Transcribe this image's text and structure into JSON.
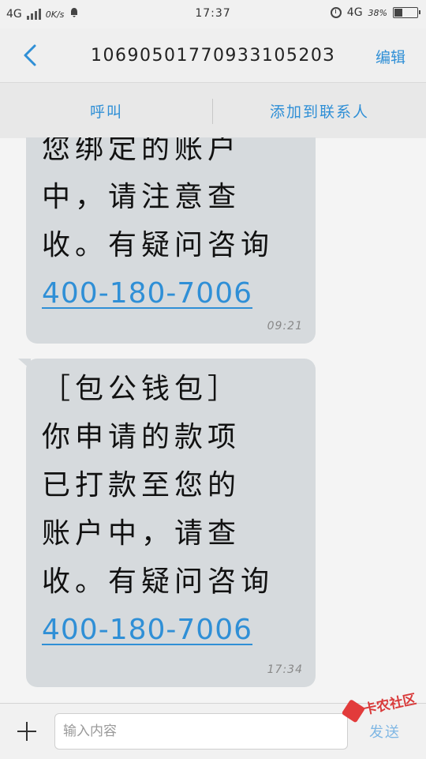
{
  "status_bar": {
    "network": "4G",
    "speed": "0K/s",
    "time": "17:37",
    "network_right": "4G",
    "battery_percent": "38%",
    "battery_level": 0.38
  },
  "header": {
    "title": "1069050177093310520З",
    "edit_label": "编辑"
  },
  "actions": {
    "call_label": "呼叫",
    "add_contact_label": "添加到联系人"
  },
  "messages": [
    {
      "lines": [
        "您绑定的账户",
        "中，请注意查",
        "收。有疑问咨询"
      ],
      "link": "400-180-7006",
      "time": "09:21"
    },
    {
      "lines": [
        "［包公钱包］",
        "你申请的款项",
        "已打款至您的",
        "账户中，请查",
        "收。有疑问咨询"
      ],
      "link": "400-180-7006",
      "time": "17:34"
    }
  ],
  "input_bar": {
    "placeholder": "输入内容",
    "send_label": "发送"
  },
  "watermark": {
    "text": "卡农社区"
  },
  "colors": {
    "accent": "#2f8fd6",
    "bubble": "#d6dadd"
  }
}
